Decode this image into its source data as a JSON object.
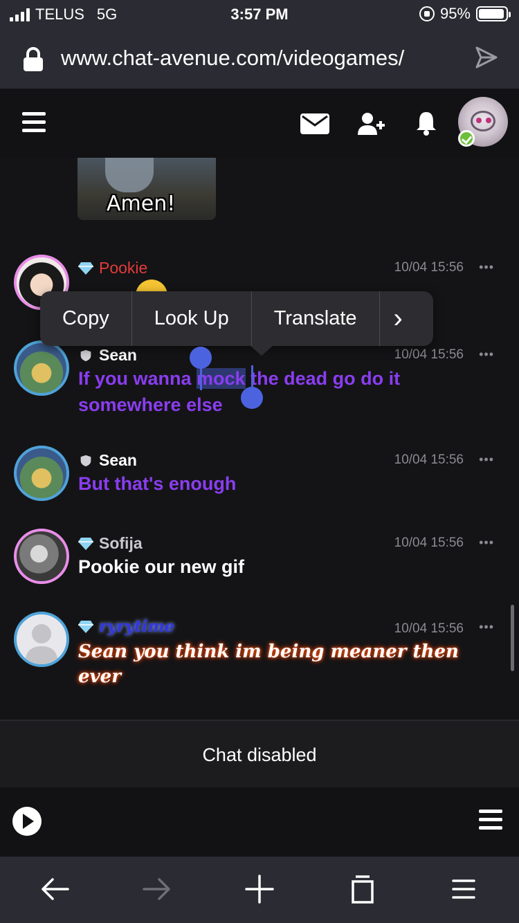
{
  "status": {
    "carrier": "TELUS",
    "network": "5G",
    "time": "3:57 PM",
    "battery": "95%",
    "battery_level": 0.95
  },
  "browser": {
    "url": "www.chat-avenue.com/videogames/"
  },
  "header_icons": [
    "menu-icon",
    "mail-icon",
    "add-friend-icon",
    "bell-icon"
  ],
  "gif": {
    "caption": "Amen!"
  },
  "messages": [
    {
      "user": "Pookie",
      "time": "10/04 15:56",
      "text": "",
      "name_color": "#e33b3b",
      "badge": "diamond"
    },
    {
      "user": "Sean",
      "time": "10/04 15:56",
      "text_before": "If you wanna ",
      "text_selected": "mock",
      "text_after": " the dead go do it somewhere else",
      "name_color": "#ffffff",
      "text_color": "#8a3df0",
      "badge": "shield"
    },
    {
      "user": "Sean",
      "time": "10/04 15:56",
      "text": "But that's enough",
      "name_color": "#ffffff",
      "text_color": "#8a3df0",
      "badge": "shield"
    },
    {
      "user": "Sofija",
      "time": "10/04 15:56",
      "text": "Pookie our new gif",
      "name_color": "#c9c9cf",
      "text_color": "#ffffff",
      "badge": "diamond"
    },
    {
      "user": "ryrytime",
      "time": "10/04 15:56",
      "text": "Sean you think im being meaner then ever",
      "name_color": "#2a2fd8",
      "text_color": "#ffffff",
      "badge": "diamond"
    }
  ],
  "context_menu": {
    "copy": "Copy",
    "look_up": "Look Up",
    "translate": "Translate",
    "more": "›"
  },
  "dots": "•••",
  "chat_disabled": "Chat disabled",
  "colors": {
    "bg": "#141416",
    "browser_chrome": "#2b2b33",
    "selection": "#4c63e0"
  }
}
